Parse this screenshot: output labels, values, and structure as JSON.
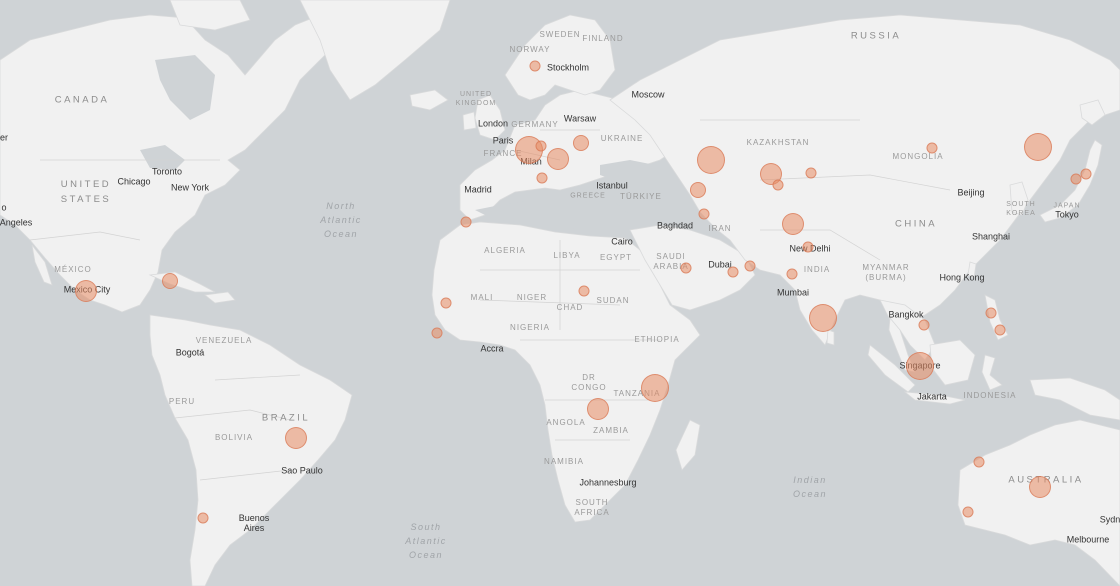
{
  "colors": {
    "water": "#cfd3d6",
    "land": "#f1f1f1",
    "bubble_fill": "rgba(232,140,100,0.55)",
    "bubble_stroke": "rgba(215,115,80,0.65)"
  },
  "labels": {
    "oceans": {
      "north_atlantic": "North\nAtlantic\nOcean",
      "south_atlantic": "South\nAtlantic\nOcean",
      "indian": "Indian\nOcean"
    },
    "countries": {
      "russia": "RUSSIA",
      "canada": "CANADA",
      "united_states": "UNITED\nSTATES",
      "mexico": "MÉXICO",
      "venezuela": "VENEZUELA",
      "brazil": "BRAZIL",
      "peru": "PERU",
      "bolivia": "BOLIVIA",
      "algeria": "ALGERIA",
      "libya": "LIBYA",
      "egypt": "EGYPT",
      "mali": "MALI",
      "niger": "NIGER",
      "chad": "CHAD",
      "sudan": "SUDAN",
      "nigeria": "NIGERIA",
      "ethiopia": "ETHIOPIA",
      "dr_congo": "DR\nCONGO",
      "tanzania": "TANZANIA",
      "angola": "ANGOLA",
      "zambia": "ZAMBIA",
      "namibia": "NAMIBIA",
      "south_africa": "SOUTH\nAFRICA",
      "saudi_arabia": "SAUDI\nARABIA",
      "iran": "IRAN",
      "india": "INDIA",
      "kazakhstan": "KAZAKHSTAN",
      "mongolia": "MONGOLIA",
      "china": "CHINA",
      "myanmar": "MYANMAR\n(BURMA)",
      "indonesia": "INDONESIA",
      "australia": "AUSTRALIA",
      "norway": "NORWAY",
      "sweden": "SWEDEN",
      "finland": "FINLAND",
      "united_kingdom": "UNITED\nKINGDOM",
      "germany": "GERMANY",
      "france": "FRANCE",
      "ukraine": "UKRAINE",
      "turkiye": "TÜRKIYE",
      "greece": "GREECE",
      "south_korea": "SOUTH\nKOREA",
      "japan": "JAPAN"
    },
    "cities": {
      "los_angeles": "Angeles",
      "vancouver_partial": "er",
      "partial_c": "o",
      "chicago": "Chicago",
      "toronto": "Toronto",
      "new_york": "New York",
      "mexico_city": "Mexico City",
      "bogota": "Bogotá",
      "sao_paulo": "Sao Paulo",
      "buenos_aires": "Buenos\nAires",
      "london": "London",
      "paris": "Paris",
      "milan": "Milan",
      "madrid": "Madrid",
      "stockholm": "Stockholm",
      "warsaw": "Warsaw",
      "moscow": "Moscow",
      "istanbul": "Istanbul",
      "cairo": "Cairo",
      "baghdad": "Baghdad",
      "dubai": "Dubai",
      "accra": "Accra",
      "johannesburg": "Johannesburg",
      "new_delhi": "New Delhi",
      "mumbai": "Mumbai",
      "beijing": "Beijing",
      "shanghai": "Shanghai",
      "hong_kong": "Hong Kong",
      "bangkok": "Bangkok",
      "singapore": "Singapore",
      "jakarta": "Jakarta",
      "tokyo": "Tokyo",
      "sydney_partial": "Sydn",
      "melbourne": "Melbourne"
    }
  },
  "markers_note": "",
  "markers": [
    {
      "place": "Mexico",
      "size": "large"
    },
    {
      "place": "Caribbean",
      "size": "medium"
    },
    {
      "place": "Brazil",
      "size": "large"
    },
    {
      "place": "Argentina",
      "size": "small"
    },
    {
      "place": "Scandinavia",
      "size": "small"
    },
    {
      "place": "France",
      "size": "xlarge"
    },
    {
      "place": "Europe-Central",
      "size": "small"
    },
    {
      "place": "Europe-Balkans",
      "size": "large"
    },
    {
      "place": "Ukraine",
      "size": "medium"
    },
    {
      "place": "Italy",
      "size": "small"
    },
    {
      "place": "Morocco",
      "size": "small"
    },
    {
      "place": "Mali",
      "size": "small"
    },
    {
      "place": "Sierra Leone",
      "size": "small"
    },
    {
      "place": "Chad",
      "size": "small"
    },
    {
      "place": "Kenya",
      "size": "xlarge"
    },
    {
      "place": "Zambia",
      "size": "large"
    },
    {
      "place": "Kazakhstan West",
      "size": "xlarge"
    },
    {
      "place": "Caspian",
      "size": "medium"
    },
    {
      "place": "Kazakhstan East",
      "size": "large"
    },
    {
      "place": "Central Asia",
      "size": "small"
    },
    {
      "place": "Iraq",
      "size": "small"
    },
    {
      "place": "Gulf",
      "size": "small"
    },
    {
      "place": "Saudi Arabia",
      "size": "small"
    },
    {
      "place": "Oman",
      "size": "small"
    },
    {
      "place": "Pakistan",
      "size": "small"
    },
    {
      "place": "North India",
      "size": "large"
    },
    {
      "place": "India Central",
      "size": "small"
    },
    {
      "place": "South India",
      "size": "xlarge"
    },
    {
      "place": "Mongolia",
      "size": "small"
    },
    {
      "place": "China North",
      "size": "small"
    },
    {
      "place": "Manchuria",
      "size": "xlarge"
    },
    {
      "place": "Japan",
      "size": "small"
    },
    {
      "place": "Japan 2",
      "size": "small"
    },
    {
      "place": "Thailand",
      "size": "small"
    },
    {
      "place": "Philippines",
      "size": "small"
    },
    {
      "place": "Philippines 2",
      "size": "small"
    },
    {
      "place": "Singapore",
      "size": "xlarge"
    },
    {
      "place": "Western Australia N",
      "size": "small"
    },
    {
      "place": "Western Australia S",
      "size": "small"
    },
    {
      "place": "Australia",
      "size": "large"
    }
  ]
}
